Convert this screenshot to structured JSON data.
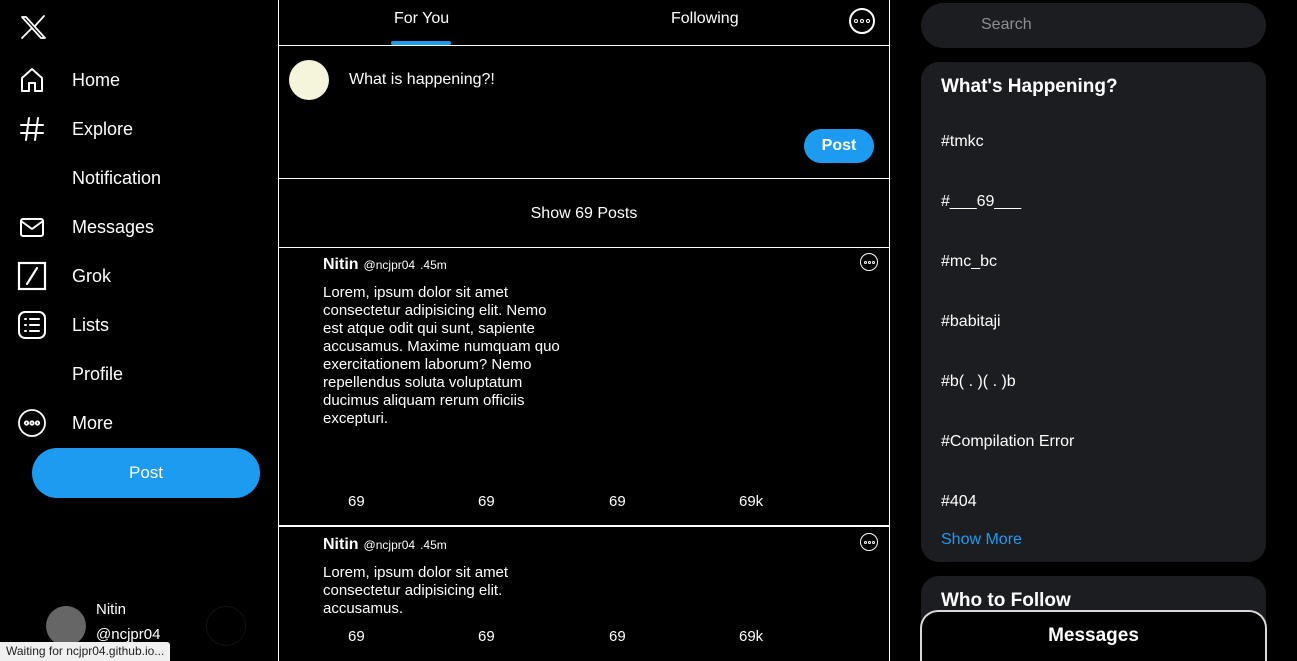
{
  "sidebar": {
    "nav": [
      {
        "label": "Home",
        "icon": "home-icon"
      },
      {
        "label": "Explore",
        "icon": "hashtag-icon"
      },
      {
        "label": "Notification",
        "icon": ""
      },
      {
        "label": "Messages",
        "icon": "envelope-icon"
      },
      {
        "label": "Grok",
        "icon": "grok-icon"
      },
      {
        "label": "Lists",
        "icon": "list-icon"
      },
      {
        "label": "Profile",
        "icon": ""
      },
      {
        "label": "More",
        "icon": "more-circle-icon"
      }
    ],
    "post_label": "Post",
    "account": {
      "name": "Nitin",
      "handle": "@ncjpr04"
    }
  },
  "status_bar": "Waiting for ncjpr04.github.io...",
  "tabs": {
    "for_you": "For You",
    "following": "Following"
  },
  "composer": {
    "placeholder": "What is happening?!",
    "post_label": "Post"
  },
  "show_posts": "Show 69 Posts",
  "tweets": [
    {
      "author": "Nitin",
      "handle": "@ncjpr04",
      "time": ".45m",
      "body": "Lorem, ipsum dolor sit amet consectetur adipisicing elit. Nemo est atque odit qui sunt, sapiente accusamus. Maxime numquam quo exercitationem laborum? Nemo repellendus soluta voluptatum ducimus aliquam rerum officiis excepturi.",
      "stats": [
        "69",
        "69",
        "69",
        "69k"
      ]
    },
    {
      "author": "Nitin",
      "handle": "@ncjpr04",
      "time": ".45m",
      "body": "Lorem, ipsum dolor sit amet consectetur adipisicing elit. accusamus.",
      "stats": [
        "69",
        "69",
        "69",
        "69k"
      ]
    }
  ],
  "search": {
    "placeholder": "Search"
  },
  "trends": {
    "title": "What's Happening?",
    "items": [
      "#tmkc",
      "#___69___",
      "#mc_bc",
      "#babitaji",
      "#b( . )( . )b",
      "#Compilation Error",
      "#404"
    ],
    "show_more": "Show More"
  },
  "who_to_follow": {
    "title": "Who to Follow"
  },
  "messages_drawer": {
    "label": "Messages"
  },
  "colors": {
    "accent": "#1d9bf0",
    "background": "#000000",
    "panel": "#1c1d20",
    "avatar_self": "#f5f5dc"
  }
}
